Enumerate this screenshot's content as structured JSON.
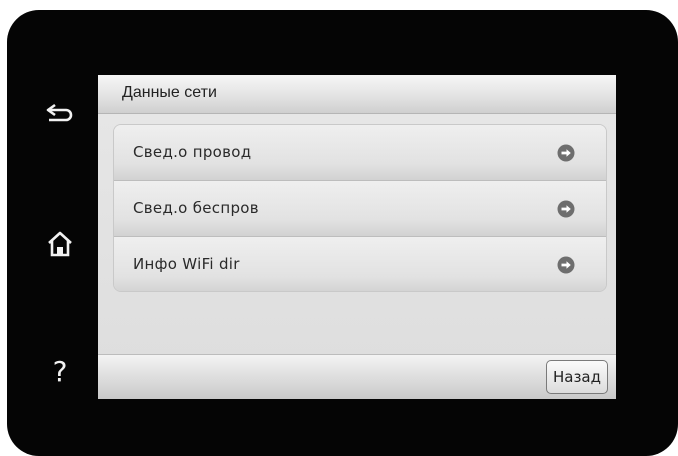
{
  "screen": {
    "title": "Данные сети",
    "items": [
      {
        "label": "Свед.о провод",
        "icon": "arrow-right-icon"
      },
      {
        "label": "Свед.о беспров",
        "icon": "arrow-right-icon"
      },
      {
        "label": "Инфо WiFi dir",
        "icon": "arrow-right-icon"
      }
    ],
    "back_label": "Назад"
  },
  "hardware": {
    "back_icon": "back-arrow-icon",
    "home_icon": "home-icon",
    "help_label": "?"
  },
  "colors": {
    "bezel": "#050505",
    "screen_bg": "#e2e2e2",
    "arrow_icon": "#6e6e6e"
  }
}
